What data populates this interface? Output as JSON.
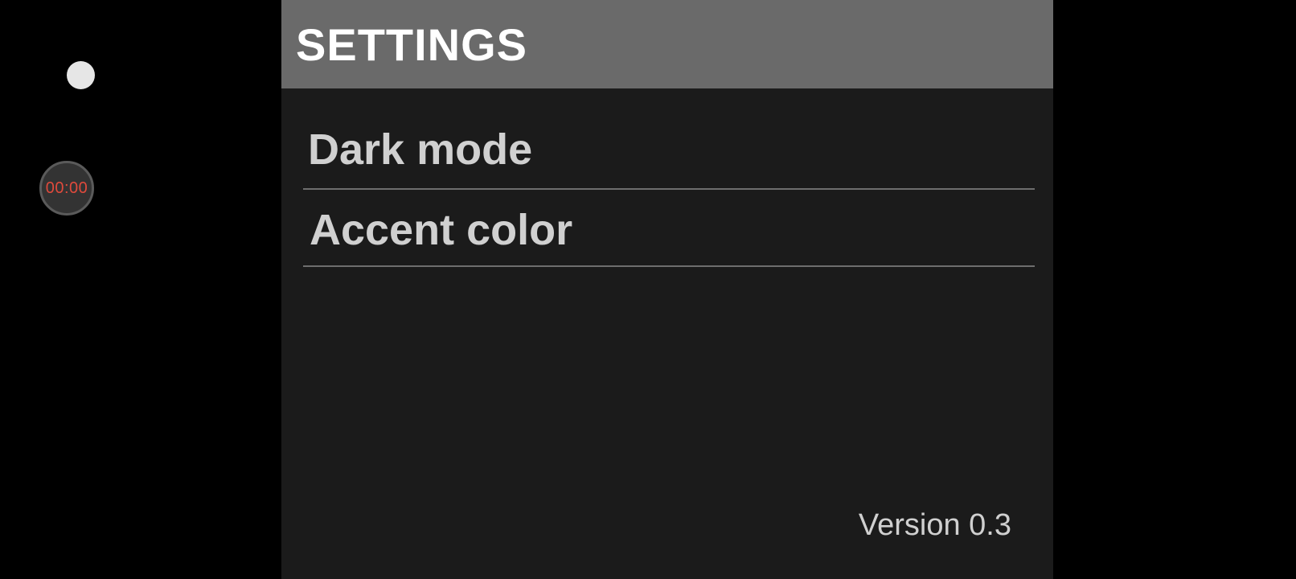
{
  "overlay": {
    "timer_text": "00:00",
    "timer_color": "#e04a3c"
  },
  "header": {
    "title": "SETTINGS",
    "background_color": "#6a6a6a"
  },
  "settings": {
    "items": [
      {
        "label": "Dark mode"
      },
      {
        "label": "Accent color"
      }
    ]
  },
  "footer": {
    "version": "Version 0.3"
  },
  "colors": {
    "panel_background": "#1b1b1b",
    "outer_background": "#000000",
    "text": "#d0d0d0",
    "divider": "#6e6e6e"
  }
}
